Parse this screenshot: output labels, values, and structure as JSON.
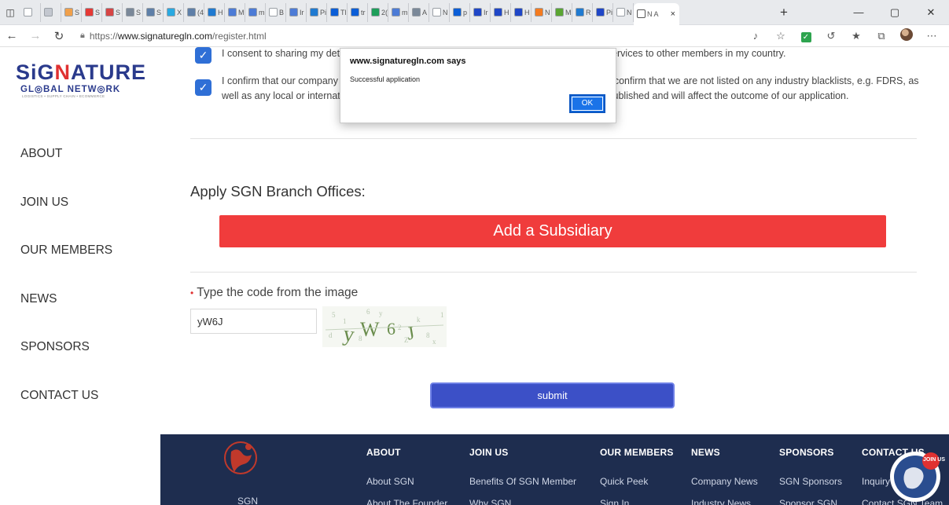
{
  "browser": {
    "tabs": [
      {
        "label": "",
        "color": "#ffffff"
      },
      {
        "label": "",
        "color": "#c3c7cf"
      },
      {
        "label": "S",
        "color": "#f0a04b"
      },
      {
        "label": "S",
        "color": "#e53935"
      },
      {
        "label": "S",
        "color": "#d64545"
      },
      {
        "label": "S",
        "color": "#7a8899"
      },
      {
        "label": "S",
        "color": "#5e7fa8"
      },
      {
        "label": "X",
        "color": "#29a9e1"
      },
      {
        "label": "(4",
        "color": "#5e7fa8"
      },
      {
        "label": "H",
        "color": "#1f7ad1"
      },
      {
        "label": "M",
        "color": "#4c7bd6"
      },
      {
        "label": "m",
        "color": "#4c7bd6"
      },
      {
        "label": "B",
        "color": "#ffffff"
      },
      {
        "label": "Ir",
        "color": "#4c7bd6"
      },
      {
        "label": "Pi",
        "color": "#1f7ad1"
      },
      {
        "label": "Tl",
        "color": "#0b5ed7"
      },
      {
        "label": "tr",
        "color": "#0b5ed7"
      },
      {
        "label": "2(",
        "color": "#1e9e5a"
      },
      {
        "label": "m",
        "color": "#4c7bd6"
      },
      {
        "label": "A",
        "color": "#7a8899"
      },
      {
        "label": "N",
        "color": "#ffffff"
      },
      {
        "label": "p",
        "color": "#0b5ed7"
      },
      {
        "label": "Ir",
        "color": "#1f46c7"
      },
      {
        "label": "H",
        "color": "#1f46c7"
      },
      {
        "label": "H",
        "color": "#1f46c7"
      },
      {
        "label": "N",
        "color": "#f47b20"
      },
      {
        "label": "M",
        "color": "#5aa532"
      },
      {
        "label": "R",
        "color": "#1f7ad1"
      },
      {
        "label": "Pi",
        "color": "#1f46c7"
      },
      {
        "label": "N",
        "color": "#ffffff"
      }
    ],
    "active_tab": {
      "label": "N A",
      "close": "×"
    },
    "new_tab": "+",
    "window_controls": {
      "minimize": "—",
      "restore": "▢",
      "close": "✕"
    },
    "url_prefix": "https://",
    "url_host": "www.signaturegln.com",
    "url_path": "/register.html"
  },
  "logo": {
    "word_left": "SiG",
    "word_red": "N",
    "word_right": "ATURE",
    "subtitle": "GL◎BAL NETW◎RK",
    "tagline": "LOGISTICS • SUPPLY CHAIN • ECOMMERCE"
  },
  "sidebar": {
    "items": [
      "ABOUT",
      "JOIN US",
      "OUR MEMBERS",
      "NEWS",
      "SPONSORS",
      "CONTACT US"
    ]
  },
  "form": {
    "consent1": "I consent to sharing my details with the network in order to promote my company and its services to other members in my country.",
    "consent2": "I confirm that our company is not involved in any legal dispute with any other forwarders. I confirm that we are not listed on any industry blacklists, e.g. FDRS, as well as any local or international groups, or any local association, as any findings can be published and will affect the outcome of our application.",
    "branch_title": "Apply SGN Branch Offices:",
    "add_subsidiary": "Add a Subsidiary",
    "code_label": "Type the code from the image",
    "code_required_mark": "•",
    "code_value": "yW6J",
    "captcha_text": "yW6J",
    "submit": "submit"
  },
  "footer": {
    "sgn_label": "SGN",
    "badge_label": "JOIN US",
    "columns": [
      {
        "title": "ABOUT",
        "items": [
          "About SGN",
          "About The Founder"
        ]
      },
      {
        "title": "JOIN US",
        "items": [
          "Benefits Of SGN Member",
          "Why SGN"
        ]
      },
      {
        "title": "OUR MEMBERS",
        "items": [
          "Quick Peek",
          "Sign In"
        ]
      },
      {
        "title": "NEWS",
        "items": [
          "Company News",
          "Industry News"
        ]
      },
      {
        "title": "SPONSORS",
        "items": [
          "SGN Sponsors",
          "Sponsor SGN"
        ]
      },
      {
        "title": "CONTACT US",
        "items": [
          "Inquiry",
          "Contact SGN Team"
        ]
      }
    ]
  },
  "dialog": {
    "title": "www.signaturegln.com says",
    "message": "Successful application",
    "ok": "OK"
  }
}
